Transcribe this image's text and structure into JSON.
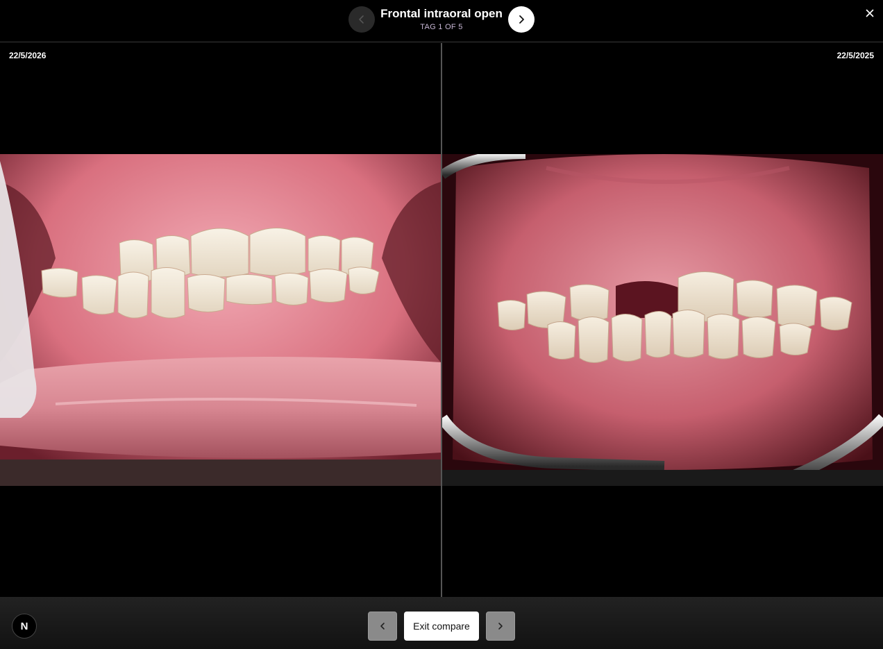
{
  "header": {
    "title": "Frontal intraoral open",
    "subtitle": "TAG 1 OF 5",
    "prev_icon": "chevron-left-icon",
    "next_icon": "chevron-right-icon",
    "close_icon": "close-icon"
  },
  "compare": {
    "left": {
      "date": "22/5/2026",
      "photo": "frontal intraoral open photo (closed bite, lip retracted by finger)"
    },
    "right": {
      "date": "22/5/2025",
      "photo": "frontal intraoral open photo (cheek retractors, missing upper central incisor)"
    }
  },
  "footer": {
    "avatar_initial": "N",
    "exit_label": "Exit compare",
    "prev_icon": "chevron-left-icon",
    "next_icon": "chevron-right-icon"
  },
  "colors": {
    "background": "#000000",
    "subtitle": "#c9b8d6",
    "footer_button": "#8a8a8a"
  }
}
